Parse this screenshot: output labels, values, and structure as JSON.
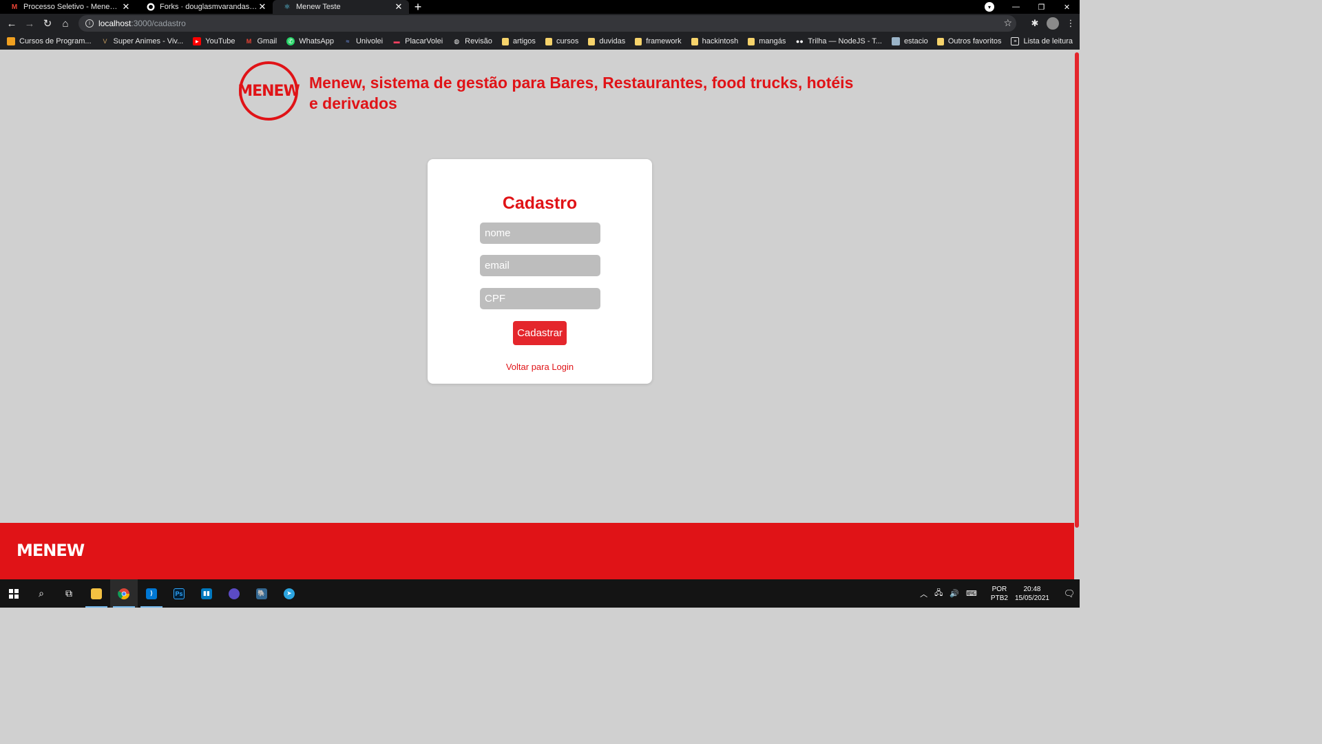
{
  "browser": {
    "tabs": [
      {
        "title": "Processo Seletivo - Menew - pat",
        "icon": "gmail-icon",
        "active": false
      },
      {
        "title": "Forks · douglasmvarandas/mene",
        "icon": "github-icon",
        "active": false
      },
      {
        "title": "Menew Teste",
        "icon": "react-icon",
        "active": true
      }
    ],
    "url_host": "localhost",
    "url_path": ":3000/cadastro",
    "bookmarks": [
      {
        "label": "Cursos de Program...",
        "icon": "bookmark-icon"
      },
      {
        "label": "Super Animes - Viv...",
        "icon": "anime-icon"
      },
      {
        "label": "YouTube",
        "icon": "youtube-icon"
      },
      {
        "label": "Gmail",
        "icon": "gmail-icon"
      },
      {
        "label": "WhatsApp",
        "icon": "whatsapp-icon"
      },
      {
        "label": "Univolei",
        "icon": "univolei-icon"
      },
      {
        "label": "PlacarVolei",
        "icon": "placar-icon"
      },
      {
        "label": "Revisão",
        "icon": "globe-icon"
      },
      {
        "label": "artigos",
        "icon": "folder-icon"
      },
      {
        "label": "cursos",
        "icon": "folder-icon"
      },
      {
        "label": "duvidas",
        "icon": "folder-icon"
      },
      {
        "label": "framework",
        "icon": "folder-icon"
      },
      {
        "label": "hackintosh",
        "icon": "folder-icon"
      },
      {
        "label": "mangás",
        "icon": "folder-icon"
      },
      {
        "label": "Trilha — NodeJS - T...",
        "icon": "medium-icon"
      },
      {
        "label": "estacio",
        "icon": "image-icon"
      }
    ],
    "other_bookmarks": "Outros favoritos",
    "reading_list": "Lista de leitura"
  },
  "page": {
    "logo_text": "MENEW",
    "headline": "Menew, sistema de gestão para Bares, Restaurantes, food trucks, hotéis e derivados",
    "form": {
      "title": "Cadastro",
      "name_placeholder": "nome",
      "email_placeholder": "email",
      "cpf_placeholder": "CPF",
      "submit_label": "Cadastrar",
      "back_link": "Voltar para Login"
    },
    "footer_logo": "MENEW"
  },
  "taskbar": {
    "language_top": "POR",
    "language_bottom": "PTB2",
    "time": "20:48",
    "date": "15/05/2021"
  },
  "colors": {
    "brand_red": "#e01317",
    "button_red": "#e4262c",
    "page_bg": "#d0d0d0",
    "input_bg": "#bdbdbd"
  }
}
